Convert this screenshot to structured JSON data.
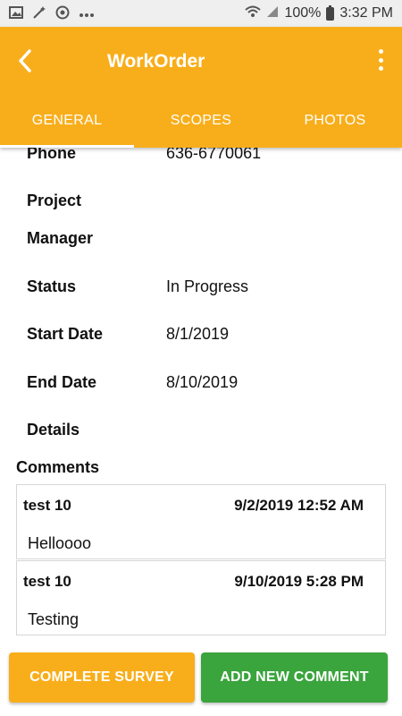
{
  "status_bar": {
    "battery": "100%",
    "time": "3:32 PM",
    "icons": [
      "image-icon",
      "magic-wand-icon",
      "chrome-icon",
      "more-dots-icon",
      "wifi-icon",
      "signal-icon",
      "battery-icon"
    ]
  },
  "app_bar": {
    "title": "WorkOrder",
    "tabs": [
      "GENERAL",
      "SCOPES",
      "PHOTOS"
    ],
    "active_tab": "GENERAL"
  },
  "details": {
    "phone_label": "Phone",
    "phone_value": "636-6770061",
    "project_label_1": "Project",
    "project_label_2": "Manager",
    "status_label": "Status",
    "status_value": "In Progress",
    "start_label": "Start Date",
    "start_value": "8/1/2019",
    "end_label": "End Date",
    "end_value": "8/10/2019",
    "details_label": "Details"
  },
  "comments": {
    "label": "Comments",
    "items": [
      {
        "user": "test 10",
        "date": "9/2/2019 12:52 AM",
        "text": "Helloooo"
      },
      {
        "user": "test 10",
        "date": "9/10/2019 5:28 PM",
        "text": "Testing"
      }
    ]
  },
  "buttons": {
    "complete_survey": "COMPLETE SURVEY",
    "add_comment": "ADD NEW COMMENT"
  },
  "colors": {
    "accent": "#f8ae1b",
    "success": "#3aa43d"
  }
}
